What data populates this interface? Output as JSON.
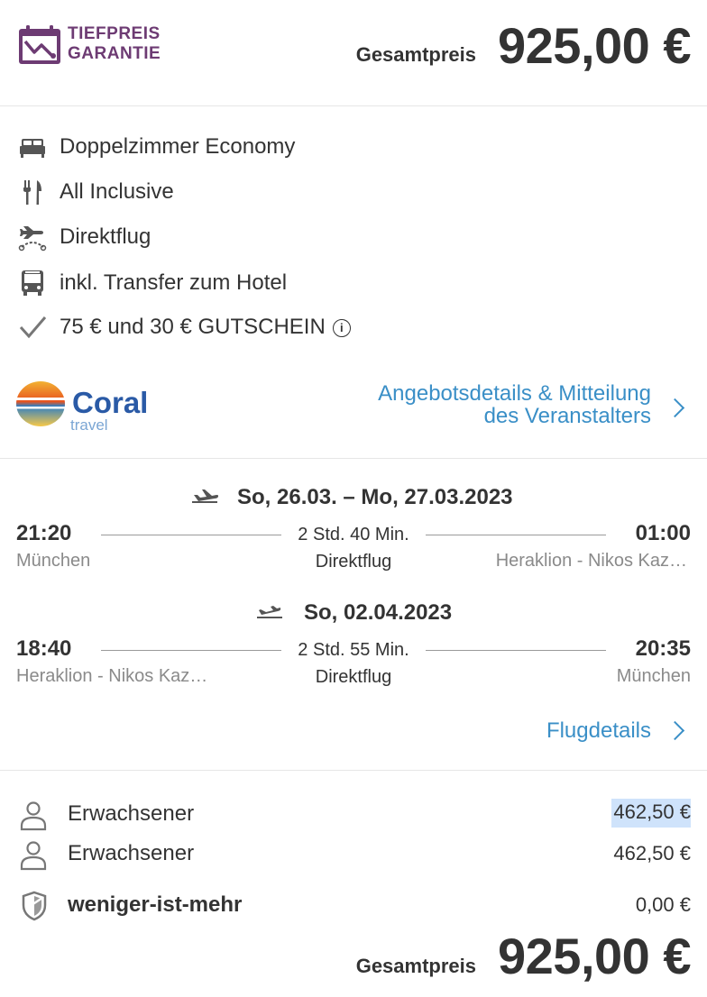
{
  "header": {
    "badge_line1": "TIEFPREIS",
    "badge_line2": "GARANTIE",
    "total_label": "Gesamtpreis",
    "total_value": "925,00 €"
  },
  "features": [
    {
      "icon": "bed-icon",
      "text": "Doppelzimmer Economy"
    },
    {
      "icon": "cutlery-icon",
      "text": "All Inclusive"
    },
    {
      "icon": "direct-flight-icon",
      "text": "Direktflug"
    },
    {
      "icon": "bus-icon",
      "text": "inkl. Transfer zum Hotel"
    },
    {
      "icon": "checkmark-icon",
      "text": "75 € und 30 € GUTSCHEIN"
    }
  ],
  "operator": {
    "logo_text": "Coral",
    "logo_subtext": "travel",
    "link_line1": "Angebotsdetails & Mitteilung",
    "link_line2": "des Veranstalters"
  },
  "flights": {
    "outbound": {
      "date": "So, 26.03. – Mo, 27.03.2023",
      "dep_time": "21:20",
      "dep_airport": "München",
      "duration": "2 Std. 40 Min.",
      "type": "Direktflug",
      "arr_time": "01:00",
      "arr_airport": "Heraklion - Nikos Kaz…"
    },
    "inbound": {
      "date": "So, 02.04.2023",
      "dep_time": "18:40",
      "dep_airport": "Heraklion - Nikos Kaz…",
      "duration": "2 Std. 55 Min.",
      "type": "Direktflug",
      "arr_time": "20:35",
      "arr_airport": "München"
    },
    "details_link": "Flugdetails"
  },
  "prices": {
    "rows": [
      {
        "icon": "person-icon",
        "label": "Erwachsener",
        "value": "462,50 €"
      },
      {
        "icon": "person-icon",
        "label": "Erwachsener",
        "value": "462,50 €"
      },
      {
        "icon": "shield-icon",
        "label": "weniger-ist-mehr",
        "value": "0,00 €"
      }
    ],
    "total_label": "Gesamtpreis",
    "total_value": "925,00 €"
  },
  "colors": {
    "brand_purple": "#6d3b73",
    "link_blue": "#3a8fc7",
    "highlight": "#cfe3fb"
  }
}
